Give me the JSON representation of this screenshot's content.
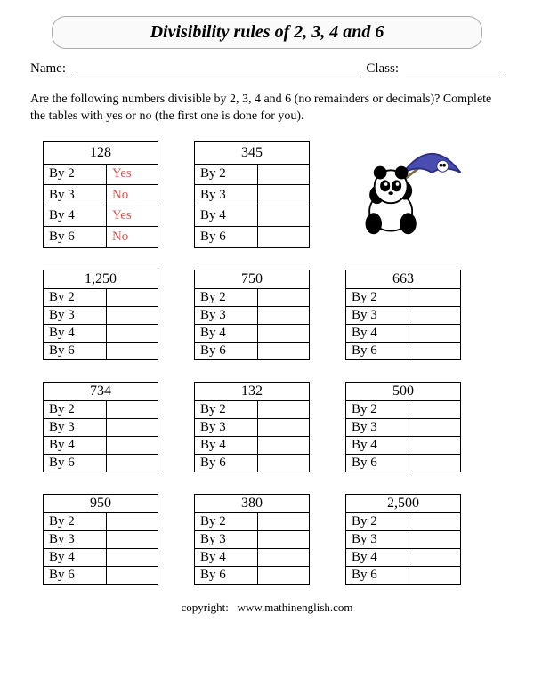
{
  "title": "Divisibility rules of 2, 3, 4 and 6",
  "labels": {
    "name": "Name:",
    "class": "Class:"
  },
  "instructions": "Are the following numbers divisible by 2, 3, 4 and 6 (no remainders or decimals)? Complete the tables with yes or no (the first one is done for you).",
  "divisors": [
    "By 2",
    "By 3",
    "By 4",
    "By 6"
  ],
  "boxes": [
    {
      "number": "128",
      "answers": [
        "Yes",
        "No",
        "Yes",
        "No"
      ]
    },
    {
      "number": "345",
      "answers": [
        "",
        "",
        "",
        ""
      ]
    },
    null,
    {
      "number": "1,250",
      "answers": [
        "",
        "",
        "",
        ""
      ]
    },
    {
      "number": "750",
      "answers": [
        "",
        "",
        "",
        ""
      ]
    },
    {
      "number": "663",
      "answers": [
        "",
        "",
        "",
        ""
      ]
    },
    {
      "number": "734",
      "answers": [
        "",
        "",
        "",
        ""
      ]
    },
    {
      "number": "132",
      "answers": [
        "",
        "",
        "",
        ""
      ]
    },
    {
      "number": "500",
      "answers": [
        "",
        "",
        "",
        ""
      ]
    },
    {
      "number": "950",
      "answers": [
        "",
        "",
        "",
        ""
      ]
    },
    {
      "number": "380",
      "answers": [
        "",
        "",
        "",
        ""
      ]
    },
    {
      "number": "2,500",
      "answers": [
        "",
        "",
        "",
        ""
      ]
    }
  ],
  "copyright": {
    "label": "copyright:",
    "site": "www.mathinenglish.com"
  },
  "icon": "panda-umbrella"
}
